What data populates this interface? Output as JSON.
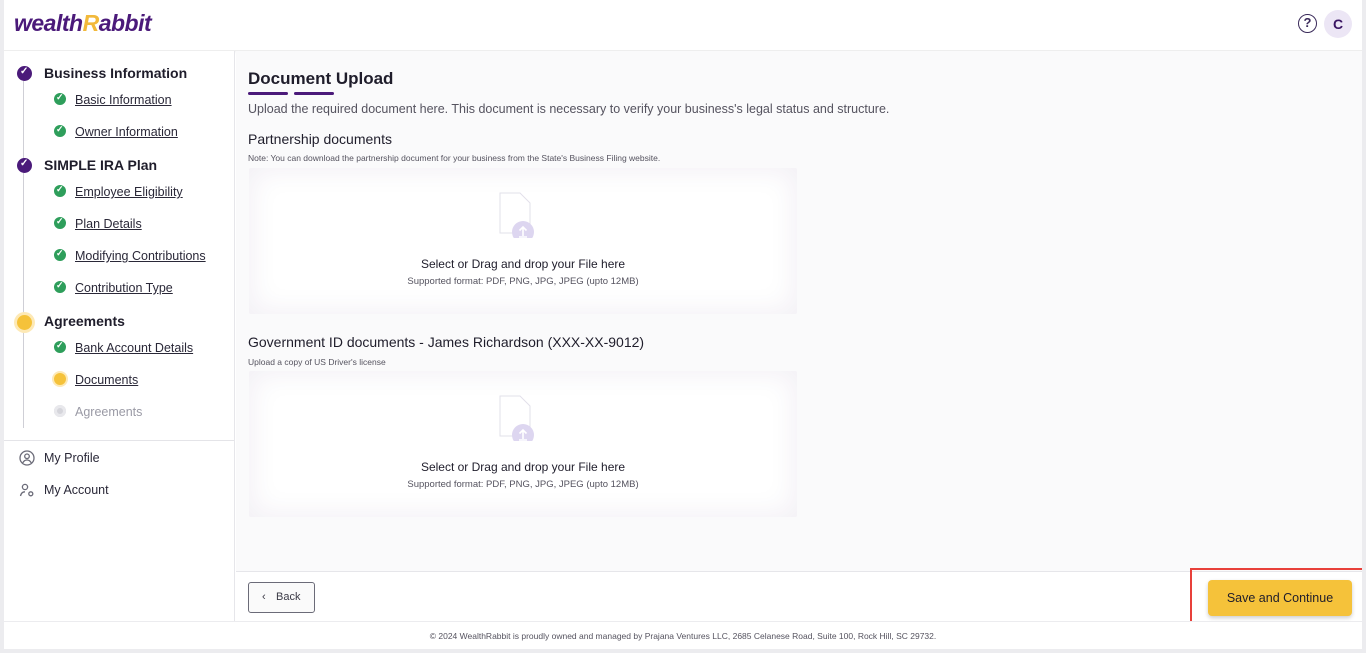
{
  "header": {
    "logo_pre": "wealth",
    "logo_r": "R",
    "logo_post": "abbit",
    "help_symbol": "?",
    "avatar_initial": "C"
  },
  "sidebar": {
    "sections": [
      {
        "label": "Business Information",
        "status": "done",
        "items": [
          {
            "label": "Basic Information",
            "status": "done"
          },
          {
            "label": "Owner Information",
            "status": "done"
          }
        ]
      },
      {
        "label": "SIMPLE IRA Plan",
        "status": "done",
        "items": [
          {
            "label": "Employee Eligibility",
            "status": "done"
          },
          {
            "label": "Plan Details",
            "status": "done"
          },
          {
            "label": "Modifying Contributions",
            "status": "done"
          },
          {
            "label": "Contribution Type",
            "status": "done"
          }
        ]
      },
      {
        "label": "Agreements",
        "status": "active",
        "items": [
          {
            "label": "Bank Account Details",
            "status": "done"
          },
          {
            "label": "Documents",
            "status": "active"
          },
          {
            "label": "Agreements",
            "status": "pending"
          }
        ]
      }
    ],
    "account_links": {
      "profile": "My Profile",
      "account": "My Account"
    }
  },
  "main": {
    "title": "Document Upload",
    "description": "Upload the required document here. This document is necessary to verify your business's legal status and structure.",
    "documents": [
      {
        "heading": "Partnership documents",
        "note": "Note: You can download the partnership document for your business from the State's Business Filing website.",
        "drop_label": "Select or Drag and drop your File here",
        "formats": "Supported format: PDF, PNG, JPG, JPEG (upto 12MB)"
      },
      {
        "heading": "Government ID documents - James Richardson (XXX-XX-9012)",
        "note": "Upload a copy of US Driver's license",
        "drop_label": "Select or Drag and drop your File here",
        "formats": "Supported format: PDF, PNG, JPG, JPEG (upto 12MB)"
      }
    ]
  },
  "actions": {
    "back": "Back",
    "back_icon": "‹",
    "save": "Save and Continue"
  },
  "footer": {
    "text": "© 2024 WealthRabbit is proudly owned and managed by Prajana Ventures LLC, 2685 Celanese Road, Suite 100, Rock Hill, SC 29732."
  },
  "colors": {
    "brand": "#4b1a7a",
    "accent": "#f5c23a",
    "success": "#2e9e5b",
    "highlight": "#e8403a"
  }
}
